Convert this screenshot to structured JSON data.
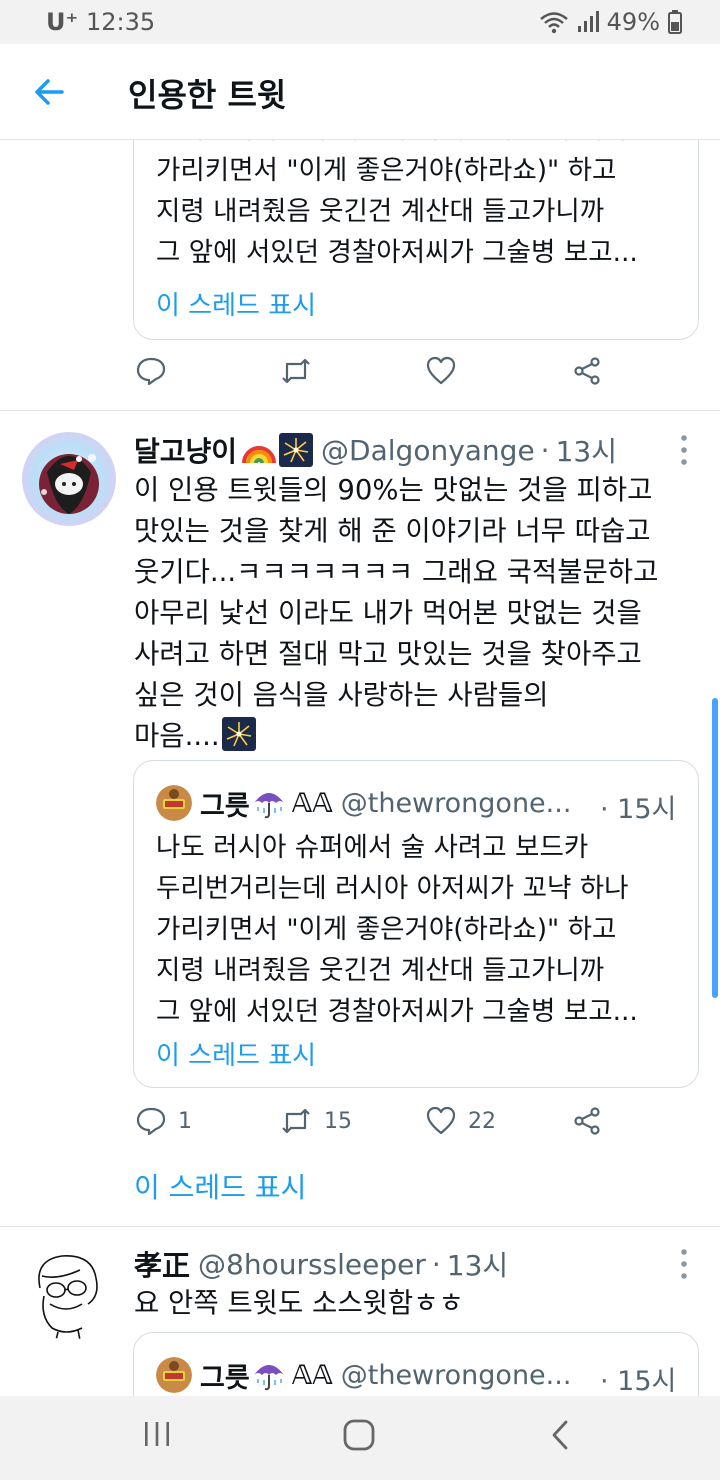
{
  "status_bar": {
    "carrier": "U⁺",
    "time": "12:35",
    "battery": "49%"
  },
  "header": {
    "title": "인용한 트윗"
  },
  "top_quote": {
    "lines": "두리번거리는데 러시아 아저씨가 꼬냑 하나\n가리키면서 \"이게 좋은거야(하라쇼)\" 하고\n지령 내려줬음 웃긴건 계산대 들고가니까\n그 앞에 서있던 경찰아저씨가 그술병 보고...",
    "show_thread": "이 스레드 표시"
  },
  "tweets": [
    {
      "name": "달고냥이",
      "handle": "@Dalgonyange",
      "dot": "·",
      "time": "13시",
      "body": "이 인용 트윗들의 90%는 맛없는 것을 피하고\n맛있는 것을 찾게 해 준 이야기라 너무 따숩고\n웃기다...ㅋㅋㅋㅋㅋㅋㅋ 그래요 국적불문하고\n아무리 낯선 이라도 내가 먹어본 맛없는 것을\n사려고 하면 절대 막고 맛있는 것을 찾아주고\n싶은 것이 음식을 사랑하는 사람들의\n마음....",
      "quote": {
        "name": "그릇",
        "handle": "@thewrongone...",
        "time": "· 15시",
        "text": "나도 러시아 슈퍼에서 술 사려고 보드카\n두리번거리는데 러시아 아저씨가 꼬냑 하나\n가리키면서 \"이게 좋은거야(하라쇼)\" 하고\n지령 내려줬음 웃긴건 계산대 들고가니까\n그 앞에 서있던 경찰아저씨가 그술병 보고...",
        "show_thread": "이 스레드 표시"
      },
      "replies": "1",
      "retweets": "15",
      "likes": "22",
      "show_thread": "이 스레드 표시"
    },
    {
      "name": "孝正",
      "handle": "@8hourssleeper",
      "dot": "·",
      "time": "13시",
      "body": "요 안쪽 트윗도 소스윗함ㅎㅎ",
      "quote": {
        "name": "그릇",
        "handle": "@thewrongone...",
        "time": "· 15시"
      }
    }
  ],
  "colors": {
    "accent": "#1d9bf0",
    "text": "#0f1419",
    "secondary": "#536471",
    "border": "#d6dde3"
  }
}
